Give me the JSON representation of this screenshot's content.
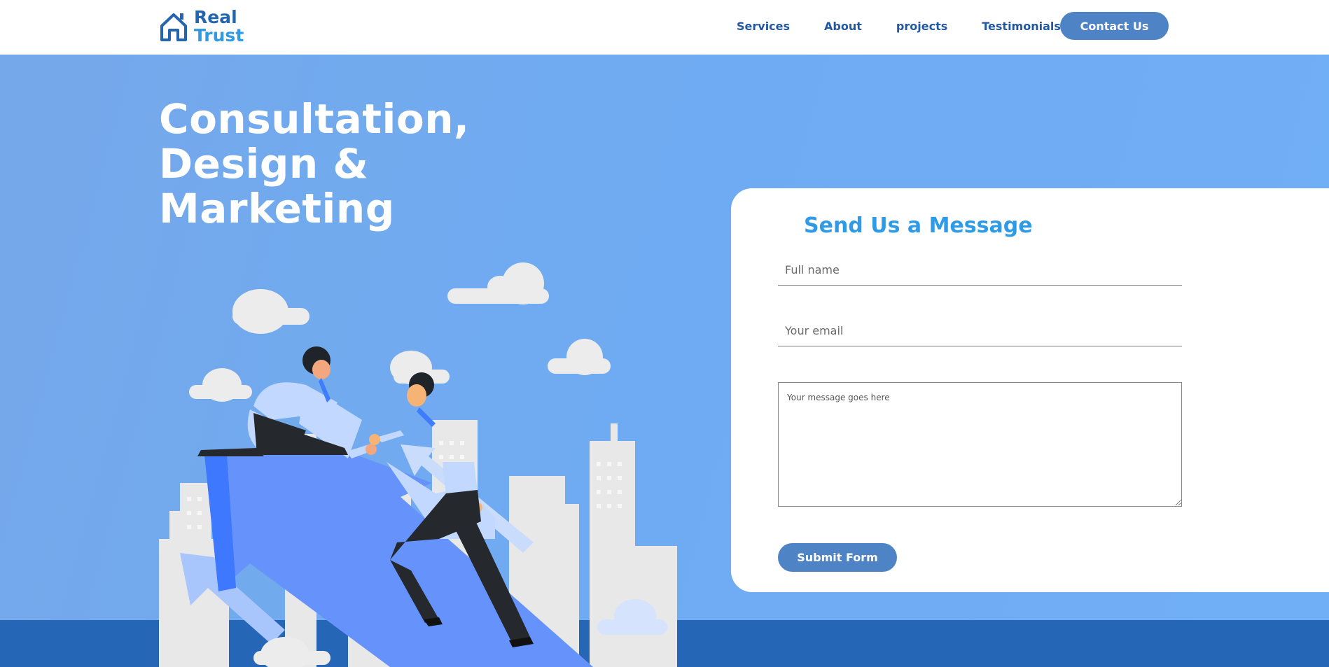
{
  "brand": {
    "line1": "Real",
    "line2": "Trust"
  },
  "nav": {
    "links": [
      "Services",
      "About",
      "projects",
      "Testimonials"
    ],
    "contact_label": "Contact Us"
  },
  "hero": {
    "title_lines": [
      "Consultation,",
      "Design &",
      "Marketing"
    ]
  },
  "form": {
    "title": "Send Us a Message",
    "name_placeholder": "Full name",
    "email_placeholder": "Your email",
    "message_placeholder": "Your message goes here",
    "submit_label": "Submit Form"
  },
  "colors": {
    "nav_text": "#2258a2",
    "button": "#4e83c6",
    "hero_bg": "#70aef6",
    "band": "#2566b6",
    "form_title": "#2f9be6"
  }
}
